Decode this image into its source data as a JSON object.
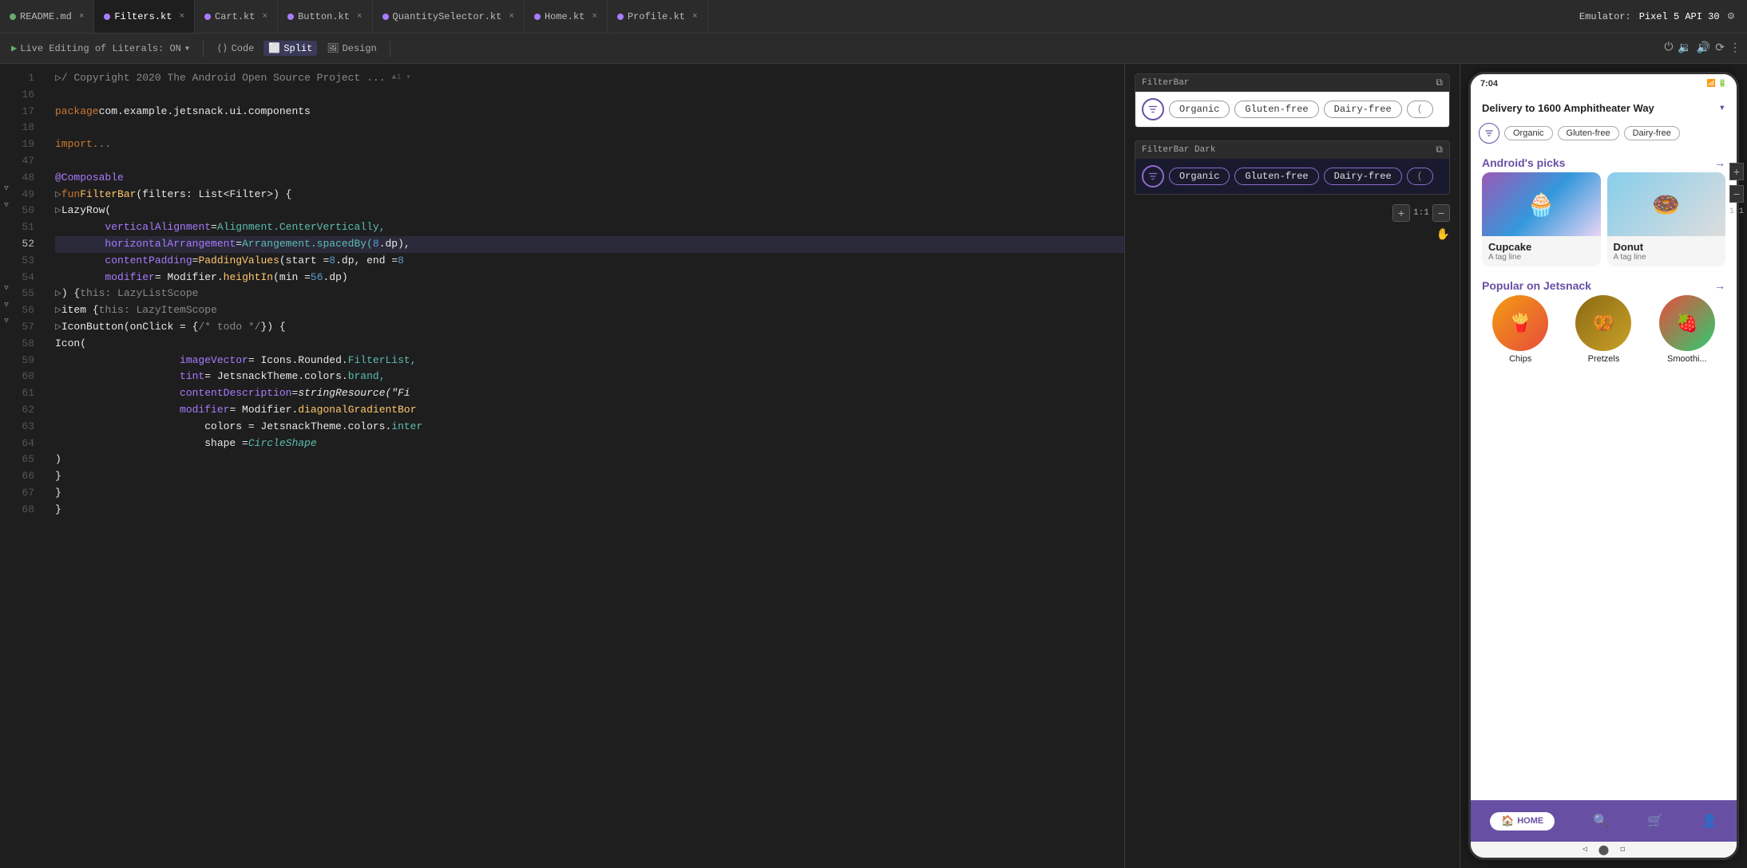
{
  "tabs": [
    {
      "label": "README.md",
      "type": "md",
      "active": false
    },
    {
      "label": "Filters.kt",
      "type": "kt",
      "active": true
    },
    {
      "label": "Cart.kt",
      "type": "kt",
      "active": false
    },
    {
      "label": "Button.kt",
      "type": "kt",
      "active": false
    },
    {
      "label": "QuantitySelector.kt",
      "type": "kt",
      "active": false
    },
    {
      "label": "Home.kt",
      "type": "kt",
      "active": false
    },
    {
      "label": "Profile.kt",
      "type": "kt",
      "active": false
    }
  ],
  "toolbar": {
    "live_editing": "Live Editing of Literals: ON",
    "code_label": "Code",
    "split_label": "Split",
    "design_label": "Design"
  },
  "emulator": {
    "label": "Emulator:",
    "device": "Pixel 5 API 30"
  },
  "code": {
    "lines": [
      {
        "num": 1,
        "tokens": [
          {
            "text": "/ Copyright 2020 The Android Open Source Project ...",
            "class": "kw-gray"
          }
        ],
        "gutter": "fold"
      },
      {
        "num": 16,
        "tokens": []
      },
      {
        "num": 17,
        "tokens": [
          {
            "text": "package ",
            "class": "kw-orange"
          },
          {
            "text": "com.example.jetsnack.ui.components",
            "class": "kw-white"
          }
        ]
      },
      {
        "num": 18,
        "tokens": []
      },
      {
        "num": 19,
        "tokens": [
          {
            "text": "import ",
            "class": "kw-orange"
          },
          {
            "text": "...",
            "class": "kw-gray"
          }
        ],
        "gutter": "fold"
      },
      {
        "num": 47,
        "tokens": []
      },
      {
        "num": 48,
        "tokens": [
          {
            "text": "@Composable",
            "class": "kw-purple"
          }
        ]
      },
      {
        "num": 49,
        "tokens": [
          {
            "text": "fun ",
            "class": "kw-orange"
          },
          {
            "text": "FilterBar",
            "class": "kw-yellow"
          },
          {
            "text": "(filters: List<Filter>) {",
            "class": "kw-white"
          }
        ],
        "gutter": "fold"
      },
      {
        "num": 50,
        "tokens": [
          {
            "text": "    LazyRow(",
            "class": "kw-white"
          }
        ],
        "gutter": "fold"
      },
      {
        "num": 51,
        "tokens": [
          {
            "text": "        ",
            "class": ""
          },
          {
            "text": "verticalAlignment",
            "class": "kw-purple"
          },
          {
            "text": " = ",
            "class": "kw-white"
          },
          {
            "text": "Alignment",
            "class": "kw-teal"
          },
          {
            "text": ".",
            "class": "kw-white"
          },
          {
            "text": "CenterVertically,",
            "class": "kw-teal"
          }
        ]
      },
      {
        "num": 52,
        "tokens": [
          {
            "text": "        ",
            "class": ""
          },
          {
            "text": "horizontalArrangement",
            "class": "kw-purple"
          },
          {
            "text": " = ",
            "class": "kw-white"
          },
          {
            "text": "Arrangement",
            "class": "kw-teal"
          },
          {
            "text": ".",
            "class": "kw-white"
          },
          {
            "text": "spacedBy(",
            "class": "kw-teal"
          },
          {
            "text": "8",
            "class": "kw-blue"
          },
          {
            "text": ".dp),",
            "class": "kw-white"
          }
        ],
        "highlighted": true
      },
      {
        "num": 53,
        "tokens": [
          {
            "text": "        ",
            "class": ""
          },
          {
            "text": "contentPadding",
            "class": "kw-purple"
          },
          {
            "text": " = ",
            "class": "kw-white"
          },
          {
            "text": "PaddingValues",
            "class": "kw-yellow"
          },
          {
            "text": "(start = ",
            "class": "kw-white"
          },
          {
            "text": "8",
            "class": "kw-blue"
          },
          {
            "text": ".dp, end = ",
            "class": "kw-white"
          },
          {
            "text": "8",
            "class": "kw-blue"
          }
        ]
      },
      {
        "num": 54,
        "tokens": [
          {
            "text": "        ",
            "class": ""
          },
          {
            "text": "modifier",
            "class": "kw-purple"
          },
          {
            "text": " = Modifier.",
            "class": "kw-white"
          },
          {
            "text": "heightIn",
            "class": "kw-yellow"
          },
          {
            "text": "(min = ",
            "class": "kw-white"
          },
          {
            "text": "56",
            "class": "kw-blue"
          },
          {
            "text": ".dp)",
            "class": "kw-white"
          }
        ]
      },
      {
        "num": 55,
        "tokens": [
          {
            "text": "    ) { ",
            "class": "kw-white"
          },
          {
            "text": "this",
            "class": "kw-gray"
          },
          {
            "text": ": LazyListScope",
            "class": "kw-gray"
          }
        ],
        "gutter": "fold"
      },
      {
        "num": 56,
        "tokens": [
          {
            "text": "        item { ",
            "class": "kw-white"
          },
          {
            "text": "this",
            "class": "kw-gray"
          },
          {
            "text": ": LazyItemScope",
            "class": "kw-gray"
          }
        ],
        "gutter": "fold"
      },
      {
        "num": 57,
        "tokens": [
          {
            "text": "            IconButton(onClick = { ",
            "class": "kw-white"
          },
          {
            "text": "/* todo */",
            "class": "kw-gray"
          },
          {
            "text": " }) {",
            "class": "kw-white"
          }
        ],
        "gutter": "fold"
      },
      {
        "num": 58,
        "tokens": [
          {
            "text": "                Icon(",
            "class": "kw-white"
          }
        ]
      },
      {
        "num": 59,
        "tokens": [
          {
            "text": "                    ",
            "class": ""
          },
          {
            "text": "imageVector",
            "class": "kw-purple"
          },
          {
            "text": " = Icons.Rounded.",
            "class": "kw-white"
          },
          {
            "text": "FilterList,",
            "class": "kw-teal"
          }
        ]
      },
      {
        "num": 60,
        "tokens": [
          {
            "text": "                    ",
            "class": ""
          },
          {
            "text": "tint",
            "class": "kw-purple"
          },
          {
            "text": " = JetsnackTheme.colors.",
            "class": "kw-white"
          },
          {
            "text": "brand,",
            "class": "kw-teal"
          }
        ]
      },
      {
        "num": 61,
        "tokens": [
          {
            "text": "                    ",
            "class": ""
          },
          {
            "text": "contentDescription",
            "class": "kw-purple"
          },
          {
            "text": " = ",
            "class": "kw-white"
          },
          {
            "text": "stringResource(\"Fi",
            "class": "kw-italic kw-white"
          }
        ]
      },
      {
        "num": 62,
        "tokens": [
          {
            "text": "                    ",
            "class": ""
          },
          {
            "text": "modifier",
            "class": "kw-purple"
          },
          {
            "text": " = Modifier.",
            "class": "kw-white"
          },
          {
            "text": "diagonalGradientBor",
            "class": "kw-yellow"
          }
        ]
      },
      {
        "num": 63,
        "tokens": [
          {
            "text": "                        colors = JetsnackTheme.colors.",
            "class": "kw-white"
          },
          {
            "text": "inter",
            "class": "kw-teal"
          }
        ]
      },
      {
        "num": 64,
        "tokens": [
          {
            "text": "                        shape = ",
            "class": "kw-white"
          },
          {
            "text": "CircleShape",
            "class": "kw-italic kw-teal"
          }
        ]
      },
      {
        "num": 65,
        "tokens": [
          {
            "text": "                )",
            "class": "kw-white"
          }
        ]
      },
      {
        "num": 66,
        "tokens": [
          {
            "text": "            }",
            "class": "kw-white"
          }
        ]
      },
      {
        "num": 67,
        "tokens": [
          {
            "text": "        }",
            "class": "kw-white"
          }
        ]
      },
      {
        "num": 68,
        "tokens": [
          {
            "text": "    }",
            "class": "kw-white"
          }
        ]
      }
    ]
  },
  "filterbar_preview": {
    "title": "FilterBar",
    "chips": [
      "Organic",
      "Gluten-free",
      "Dairy-free"
    ]
  },
  "filterbar_dark_preview": {
    "title": "FilterBar Dark",
    "chips": [
      "Organic",
      "Gluten-free",
      "Dairy-free"
    ]
  },
  "phone": {
    "time": "7:04",
    "delivery_text": "Delivery to 1600 Amphitheater Way",
    "filter_chips": [
      "Organic",
      "Gluten-free",
      "Dairy-free"
    ],
    "androids_picks_title": "Android's picks",
    "picks": [
      {
        "name": "Cupcake",
        "tag": "A tag line",
        "emoji": "🧁"
      },
      {
        "name": "Donut",
        "tag": "A tag line",
        "emoji": "🍩"
      }
    ],
    "popular_title": "Popular on Jetsnack",
    "popular": [
      {
        "name": "Chips",
        "emoji": "🍟"
      },
      {
        "name": "Pretzels",
        "emoji": "🥨"
      },
      {
        "name": "Smoothi...",
        "emoji": "🍓"
      }
    ],
    "nav": {
      "home": "HOME",
      "search_icon": "🔍",
      "cart_icon": "🛒",
      "profile_icon": "👤"
    }
  }
}
